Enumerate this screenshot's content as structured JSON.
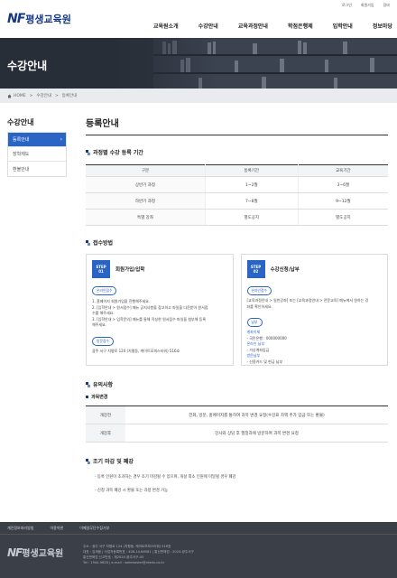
{
  "util_links": [
    "로그인",
    "회원가입",
    "장바"
  ],
  "logo": {
    "mark": "NF",
    "name": "평생교육원"
  },
  "gnb": [
    "교육원소개",
    "수강안내",
    "교육과정안내",
    "학점은행제",
    "입학안내",
    "정보마당"
  ],
  "hero": {
    "title": "수강안내"
  },
  "breadcrumb": {
    "home": "HOME",
    "level1": "수강안내",
    "level2": "등록안내"
  },
  "sidebar": {
    "title": "수강안내",
    "items": [
      {
        "label": "등록안내",
        "active": true
      },
      {
        "label": "장학제도",
        "active": false
      },
      {
        "label": "환불안내",
        "active": false
      }
    ]
  },
  "page_title": "등록안내",
  "section1": {
    "title": "과정별 수강 등록 기간",
    "headers": [
      "구분",
      "등록기간",
      "교육기간"
    ],
    "rows": [
      [
        "상반기 과정",
        "1~2월",
        "3~6월"
      ],
      [
        "하반기 과정",
        "7~8월",
        "9~12월"
      ],
      [
        "특별 강좌",
        "별도공지",
        "별도공지"
      ]
    ]
  },
  "section2": {
    "title": "접수방법",
    "step1": {
      "step_label": "STEP",
      "step_no": "01",
      "title": "회원가입/입학",
      "pill1": "온라인접수",
      "lines": [
        "1. 홈페이지 회원가입을 진행해주세요.",
        "2. [입학안내 > 원서접수] 메뉴 공지사항을 참고하고 파일을 다운받아 원서접",
        "수를 해주세요.",
        "3. [입학안내 > 입학문의] 메뉴를 통해 작성한 원서접수 파일을 첨부해 등록",
        "해주세요."
      ],
      "pill2": "방문접수",
      "visit_text": "광주 서구 치평로 124 (치평동, 케이트모피스타워) 516호"
    },
    "step2": {
      "step_label": "STEP",
      "step_no": "02",
      "title": "수강신청/납부",
      "pill1": "온라인접수",
      "lines": [
        "[교육과정안내 > 일반강좌] 또는 [교육과정안내 > 전문교육] 메뉴에서 원하는 강",
        "좌를 확인하세요."
      ],
      "pill2": "납부",
      "account_head": "계좌이체",
      "account_line": "- 국민은행 : 000000000",
      "online_head": "온라인 납부",
      "online_line": "- 가상계좌입금",
      "visit_head": "방문납부",
      "visit_line": "- 신용카드 및 현금 납부"
    }
  },
  "section3": {
    "title": "유의사항",
    "subtitle": "과목변경",
    "rows": [
      [
        "개강전",
        "전화, 방문, 홈페이지를 통하여 과목 변경 요청(수강료 차액 추가 입금 또는 환불)"
      ],
      [
        "개강후",
        "강사와 상담 후 행정과에 방문하여 과목 변경 요청"
      ]
    ]
  },
  "section4": {
    "title": "조기 마감 및 폐강",
    "notes": [
      "- 등록 인원이 초과하는 경우 조기 마감될 수 있으며, 개설 최소 인원에 미달될 경우 폐강",
      "- 신청 과목 폐강 시 환불 또는 과정 변경 가능"
    ]
  },
  "footer": {
    "links": [
      "개인정보처리방침",
      "이용약관",
      "이메일무단수집거부"
    ],
    "logo_mark": "NF",
    "logo_name": "평생교육원",
    "info": [
      "주소 : 광주 서구 치평로 124 (치평동, 케이트모피스타워) 516호",
      "대표 : 임재웅 | 사업자등록번호 : 408-14-68581 | 통신판매업 : 2024-광주서구",
      "통신판매업 신고번호 : 제2024-광주서구-45",
      "Tel : 1544-9628 | e-mail : webmaster@nfedu.co.kr"
    ]
  }
}
